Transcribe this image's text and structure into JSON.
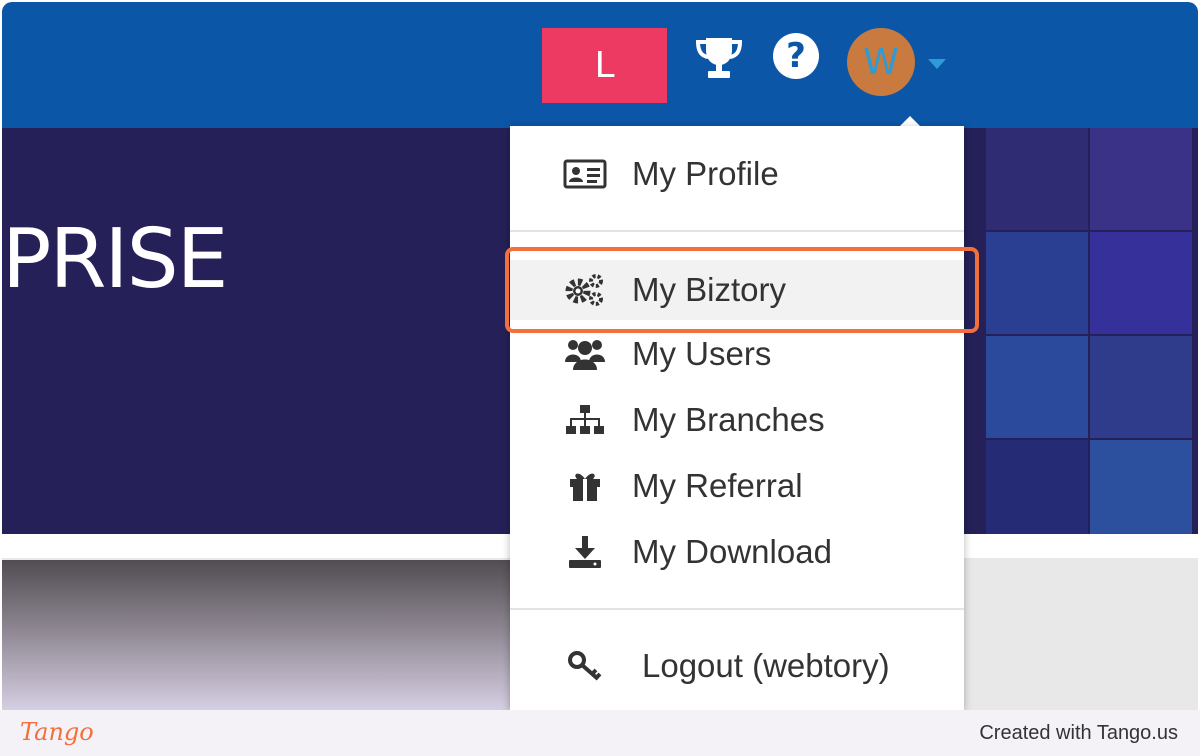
{
  "header": {
    "workspace_initial": "L",
    "trophy_icon": "trophy-icon",
    "help_icon": "question-circle-icon",
    "help_glyph": "?",
    "user_initial": "W",
    "menu_caret_icon": "caret-down-icon",
    "colors": {
      "bar": "#0b56a6",
      "badge": "#ec3a63",
      "avatar": "#c87a3f",
      "avatar_text": "#2f9bd6"
    }
  },
  "hero": {
    "title_fragment": "PRISE",
    "background": "#252058"
  },
  "user_menu": {
    "items": [
      {
        "label": "My Profile",
        "icon": "id-card-icon"
      },
      {
        "label": "My Biztory",
        "icon": "cogs-icon",
        "highlighted": true
      },
      {
        "label": "My Users",
        "icon": "users-icon"
      },
      {
        "label": "My Branches",
        "icon": "sitemap-icon"
      },
      {
        "label": "My Referral",
        "icon": "gift-icon"
      },
      {
        "label": "My Download",
        "icon": "download-icon"
      }
    ],
    "logout": {
      "label": "Logout (webtory)",
      "icon": "key-icon"
    },
    "highlight_color": "#f36f3b"
  },
  "footer": {
    "logo_text": "Tango",
    "credit": "Created with Tango.us"
  }
}
